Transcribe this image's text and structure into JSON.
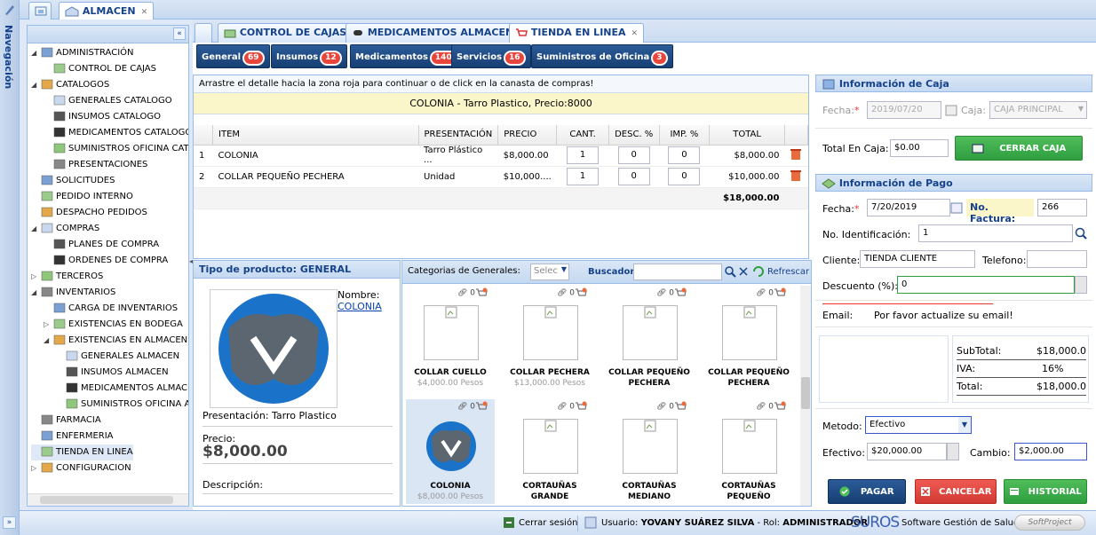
{
  "sidebar": {
    "label": "Navegación",
    "expand_label": "»"
  },
  "top_tab": {
    "label": "ALMACEN"
  },
  "tree": {
    "collapse_label": "«",
    "items": [
      {
        "label": "ADMINISTRACIÓN",
        "indent": 0,
        "tog": "◢"
      },
      {
        "label": "CONTROL DE CAJAS",
        "indent": 1,
        "tog": ""
      },
      {
        "label": "CATALOGOS",
        "indent": 0,
        "tog": "◢"
      },
      {
        "label": "GENERALES CATALOGO",
        "indent": 1,
        "tog": ""
      },
      {
        "label": "INSUMOS CATALOGO",
        "indent": 1,
        "tog": ""
      },
      {
        "label": "MEDICAMENTOS CATALOGO",
        "indent": 1,
        "tog": ""
      },
      {
        "label": "SUMINISTROS OFICINA CATA",
        "indent": 1,
        "tog": ""
      },
      {
        "label": "PRESENTACIONES",
        "indent": 1,
        "tog": ""
      },
      {
        "label": "SOLICITUDES",
        "indent": 0,
        "tog": ""
      },
      {
        "label": "PEDIDO INTERNO",
        "indent": 0,
        "tog": ""
      },
      {
        "label": "DESPACHO PEDIDOS",
        "indent": 0,
        "tog": ""
      },
      {
        "label": "COMPRAS",
        "indent": 0,
        "tog": "◢"
      },
      {
        "label": "PLANES DE COMPRA",
        "indent": 1,
        "tog": ""
      },
      {
        "label": "ORDENES DE COMPRA",
        "indent": 1,
        "tog": ""
      },
      {
        "label": "TERCEROS",
        "indent": 0,
        "tog": "▷"
      },
      {
        "label": "INVENTARIOS",
        "indent": 0,
        "tog": "◢"
      },
      {
        "label": "CARGA DE INVENTARIOS",
        "indent": 1,
        "tog": ""
      },
      {
        "label": "EXISTENCIAS EN BODEGA",
        "indent": 1,
        "tog": "▷"
      },
      {
        "label": "EXISTENCIAS EN ALMACEN",
        "indent": 1,
        "tog": "◢"
      },
      {
        "label": "GENERALES ALMACEN",
        "indent": 2,
        "tog": ""
      },
      {
        "label": "INSUMOS ALMACEN",
        "indent": 2,
        "tog": ""
      },
      {
        "label": "MEDICAMENTOS ALMACEN",
        "indent": 2,
        "tog": ""
      },
      {
        "label": "SUMINISTROS OFICINA AL",
        "indent": 2,
        "tog": ""
      },
      {
        "label": "FARMACIA",
        "indent": 0,
        "tog": ""
      },
      {
        "label": "ENFERMERIA",
        "indent": 0,
        "tog": ""
      },
      {
        "label": "TIENDA EN LINEA",
        "indent": 0,
        "tog": ""
      },
      {
        "label": "CONFIGURACION",
        "indent": 0,
        "tog": "▷"
      }
    ]
  },
  "tabs": [
    {
      "label": "CONTROL DE CAJAS"
    },
    {
      "label": "MEDICAMENTOS ALMACEN"
    },
    {
      "label": "TIENDA EN LINEA"
    }
  ],
  "categories": [
    {
      "label": "General",
      "count": "69"
    },
    {
      "label": "Insumos",
      "count": "12"
    },
    {
      "label": "Medicamentos",
      "count": "140"
    },
    {
      "label": "Servicios",
      "count": "16"
    },
    {
      "label": "Suministros de Oficina",
      "count": "3"
    }
  ],
  "cart": {
    "instruction": "Arrastre el detalle hacia la zona roja para continuar o de click en la canasta de compras!",
    "selected": "COLONIA - Tarro Plastico, Precio:8000",
    "columns": [
      "ITEM",
      "PRESENTACIÓN",
      "PRECIO",
      "CANT.",
      "DESC. %",
      "IMP. %",
      "TOTAL"
    ],
    "rows": [
      {
        "n": "1",
        "item": "COLONIA",
        "pres": "Tarro Plástico ...",
        "precio": "$8,000.00",
        "cant": "1",
        "desc": "0",
        "imp": "0",
        "total": "$8,000.00"
      },
      {
        "n": "2",
        "item": "COLLAR PEQUEÑO PECHERA",
        "pres": "Unidad",
        "precio": "$10,000....",
        "cant": "1",
        "desc": "0",
        "imp": "0",
        "total": "$10,000.00"
      }
    ],
    "grand_total": "$18,000.00"
  },
  "product_detail": {
    "header": "Tipo de producto: GENERAL",
    "name_label": "Nombre:",
    "name_value": "COLONIA",
    "presentation": "Presentación: Tarro Plastico",
    "price_label": "Precio:",
    "price_value": "$8,000.00",
    "description_label": "Descripción:"
  },
  "catalog": {
    "category_label": "Categorias de Generales:",
    "select_placeholder": "Selec",
    "search_label": "Buscador:",
    "refresh_label": "Refrescar",
    "products": [
      {
        "name": "COLLAR CUELLO",
        "price": "$4,000.00 Pesos",
        "count": "0"
      },
      {
        "name": "COLLAR PECHERA",
        "price": "$13,000.00 Pesos",
        "count": "0"
      },
      {
        "name": "COLLAR PEQUEÑO PECHERA",
        "price": "",
        "count": "0"
      },
      {
        "name": "COLLAR PEQUEÑO PECHERA",
        "price": "",
        "count": "0"
      },
      {
        "name": "COLONIA",
        "price": "$8,000.00 Pesos",
        "count": "0"
      },
      {
        "name": "CORTAUÑAS GRANDE",
        "price": "",
        "count": "0"
      },
      {
        "name": "CORTAUÑAS MEDIANO",
        "price": "",
        "count": "0"
      },
      {
        "name": "CORTAUÑAS PEQUEÑO",
        "price": "",
        "count": "0"
      }
    ]
  },
  "caja": {
    "header": "Información de Caja",
    "fecha_label": "Fecha:",
    "fecha_value": "2019/07/20",
    "caja_label": "Caja:",
    "caja_value": "CAJA PRINCIPAL",
    "total_label": "Total En Caja:",
    "total_value": "$0.00",
    "cerrar_label": "CERRAR CAJA"
  },
  "pago": {
    "header": "Información de Pago",
    "fecha_label": "Fecha:",
    "fecha_value": "7/20/2019",
    "factura_label": "No. Factura:",
    "factura_value": "266",
    "ident_label": "No. Identificación:",
    "ident_value": "1",
    "cliente_label": "Cliente:",
    "cliente_value": "TIENDA  CLIENTE",
    "telefono_label": "Telefono:",
    "telefono_value": "",
    "descuento_label": "Descuento (%):",
    "descuento_value": "0",
    "email_label": "Email:",
    "email_value": "Por favor actualize su email!",
    "subtotal_label": "SubTotal:",
    "subtotal_value": "$18,000.0",
    "iva_label": "IVA:",
    "iva_value": "16%",
    "total_label": "Total:",
    "total_value": "$18,000.0",
    "metodo_label": "Metodo:",
    "metodo_value": "Efectivo",
    "efectivo_label": "Efectivo:",
    "efectivo_value": "$20,000.00",
    "cambio_label": "Cambio:",
    "cambio_value": "$2,000.00",
    "pagar_label": "PAGAR",
    "cancelar_label": "CANCELAR",
    "historial_label": "HISTORIAL"
  },
  "status": {
    "logout": "Cerrar sesión",
    "user_prefix": "Usuario:",
    "user_name": "YOVANY SUÁREZ SILVA",
    "role_prefix": "- Rol:",
    "role": "ADMINISTRADOR",
    "brand": "SUROS",
    "brand_text": "Software Gestión de Salud",
    "brand2": "SoftProject"
  },
  "colors": {
    "accent": "#15428b",
    "danger": "#e8453c",
    "success": "#2f9e3f",
    "navy": "#1f4e8c"
  }
}
